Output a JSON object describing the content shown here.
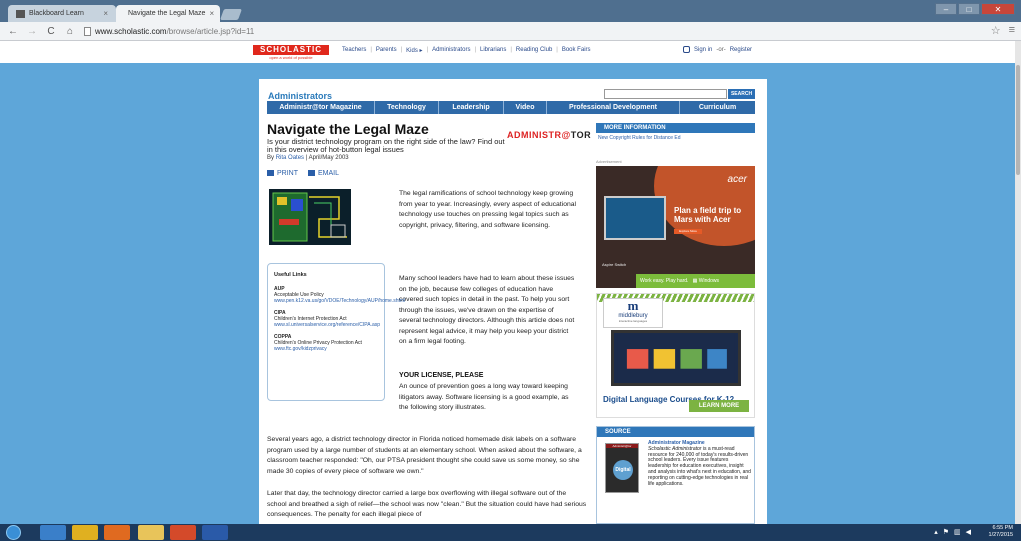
{
  "browser": {
    "tabs": [
      {
        "label": "Blackboard Learn",
        "active": false
      },
      {
        "label": "Navigate the Legal Maze",
        "active": true
      }
    ],
    "url_host": "www.scholastic.com",
    "url_path": "/browse/article.jsp?id=11",
    "close_glyph": "×",
    "win_min": "–",
    "win_max": "□",
    "win_close": "✕",
    "back": "←",
    "forward": "→",
    "reload": "C",
    "home": "⌂",
    "star": "☆",
    "menu": "≡"
  },
  "site": {
    "logo": "SCHOLASTIC",
    "tagline": "open a world of possible",
    "topnav": [
      "Teachers",
      "Parents",
      "Kids ▸",
      "Administrators",
      "Librarians",
      "Reading Club",
      "Book Fairs"
    ],
    "signin": "Sign in",
    "or": "-or-",
    "register": "Register"
  },
  "section": {
    "title": "Administrators",
    "search_button": "SEARCH",
    "nav": [
      "Administr@tor Magazine",
      "Technology",
      "Leadership",
      "Video",
      "Professional Development",
      "Curriculum"
    ]
  },
  "article": {
    "title": "Navigate the Legal Maze",
    "subtitle": "Is your district technology program on the right side of the law? Find out in this overview of hot-button legal issues",
    "by": "By",
    "author": "Rita Oates",
    "date": "| April/May 2003",
    "magazine_logo_red": "ADMINISTR",
    "magazine_logo_at": "@",
    "magazine_logo_tail": "TOR",
    "print": "PRINT",
    "email": "EMAIL",
    "p1": "The legal ramifications of school technology keep growing from year to year. Increasingly, every aspect of educational technology use touches on pressing legal topics such as copyright, privacy, filtering, and software licensing.",
    "p2": "Many school leaders have had to learn about these issues on the job, because few colleges of education have covered such topics in detail in the past. To help you sort through the issues, we've drawn on the expertise of several technology directors. Although this article does not represent legal advice, it may help you keep your district on a firm legal footing.",
    "h2": "YOUR LICENSE, PLEASE",
    "p3": "An ounce of prevention goes a long way toward keeping litigators away. Software licensing is a good example, as the following story illustrates.",
    "p4": "Several years ago, a district technology director in Florida noticed homemade disk labels on a software program used by a large number of students at an elementary school. When asked about the software, a classroom teacher responded: \"Oh, our PTSA president thought she could save us some money, so she made 30 copies of every piece of software we own.\"",
    "p5": "Later that day, the technology director carried a large box overflowing with illegal software out of the school and breathed a sigh of relief—the school was now \"clean.\" But the situation could have had serious consequences. The penalty for each illegal piece of"
  },
  "useful_links": {
    "heading": "Useful Links",
    "groups": [
      {
        "name": "AUP",
        "desc": "Acceptable Use Policy",
        "link": "www.pen.k12.va.us/go/VDOE/Technology/AUP/home.shtml"
      },
      {
        "name": "CIPA",
        "desc": "Children's Internet Protection Act",
        "link": "www.sl.universalservice.org/reference/CIPA.asp"
      },
      {
        "name": "COPPA",
        "desc": "Children's Online Privacy Protection Act",
        "link": "www.ftc.gov/kidzprivacy"
      }
    ]
  },
  "sidebar": {
    "more_info_heading": "MORE INFORMATION",
    "more_info_link": "New Copyright Rules for Distance Ed",
    "ad_label": "Advertisement",
    "acer": {
      "brand": "acer",
      "headline": "Plan a field trip to Mars with Acer",
      "cta": "Explore More",
      "product": "Aspire Switch",
      "tagline": "Work easy. Play hard.",
      "windows": "Windows"
    },
    "middlebury": {
      "logo_letter": "m",
      "name": "middlebury",
      "sub": "interactive languages",
      "headline": "Digital Language Courses for K-12",
      "cta": "LEARN MORE"
    },
    "source": {
      "heading": "SOURCE",
      "cover_title": "Administr@tor",
      "cover_badge": "Digital",
      "mag_title": "Administrator Magazine",
      "italic": "Scholastic Administrator",
      "desc": "is a must-read resource for 240,000 of today's results-driven school leaders. Every issue features leadership for education executives, insight and analysis into what's next in education, and reporting on cutting-edge technologies in real life applications."
    }
  },
  "taskbar": {
    "time": "6:55 PM",
    "date": "1/27/2015",
    "apps": [
      {
        "name": "ie",
        "color": "#3a7fc9"
      },
      {
        "name": "chrome",
        "color": "#e0b020"
      },
      {
        "name": "firefox",
        "color": "#e06a20"
      },
      {
        "name": "explorer",
        "color": "#e8c45a"
      },
      {
        "name": "media",
        "color": "#d44a2a"
      },
      {
        "name": "word",
        "color": "#2a5aa8"
      }
    ]
  }
}
